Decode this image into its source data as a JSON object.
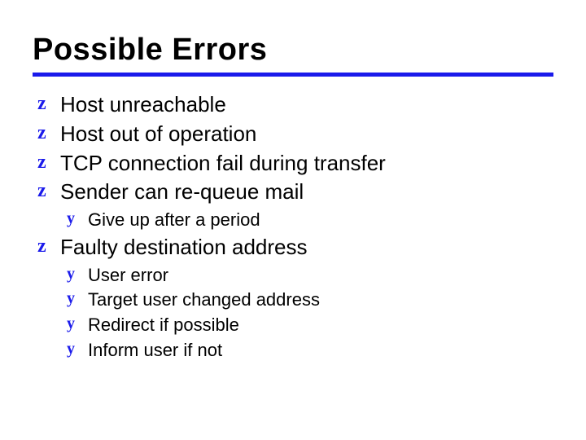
{
  "title": "Possible Errors",
  "accent_color": "#1a1aeb",
  "bullets": {
    "l1_glyph": "z",
    "l2_glyph": "y"
  },
  "items": [
    {
      "level": 1,
      "text": "Host unreachable"
    },
    {
      "level": 1,
      "text": "Host out of operation"
    },
    {
      "level": 1,
      "text": "TCP connection fail during transfer"
    },
    {
      "level": 1,
      "text": "Sender can re-queue mail"
    },
    {
      "level": 2,
      "text": "Give up after a period"
    },
    {
      "level": 1,
      "text": "Faulty destination address"
    },
    {
      "level": 2,
      "text": "User error"
    },
    {
      "level": 2,
      "text": "Target user changed address"
    },
    {
      "level": 2,
      "text": "Redirect if possible"
    },
    {
      "level": 2,
      "text": "Inform user if not"
    }
  ]
}
